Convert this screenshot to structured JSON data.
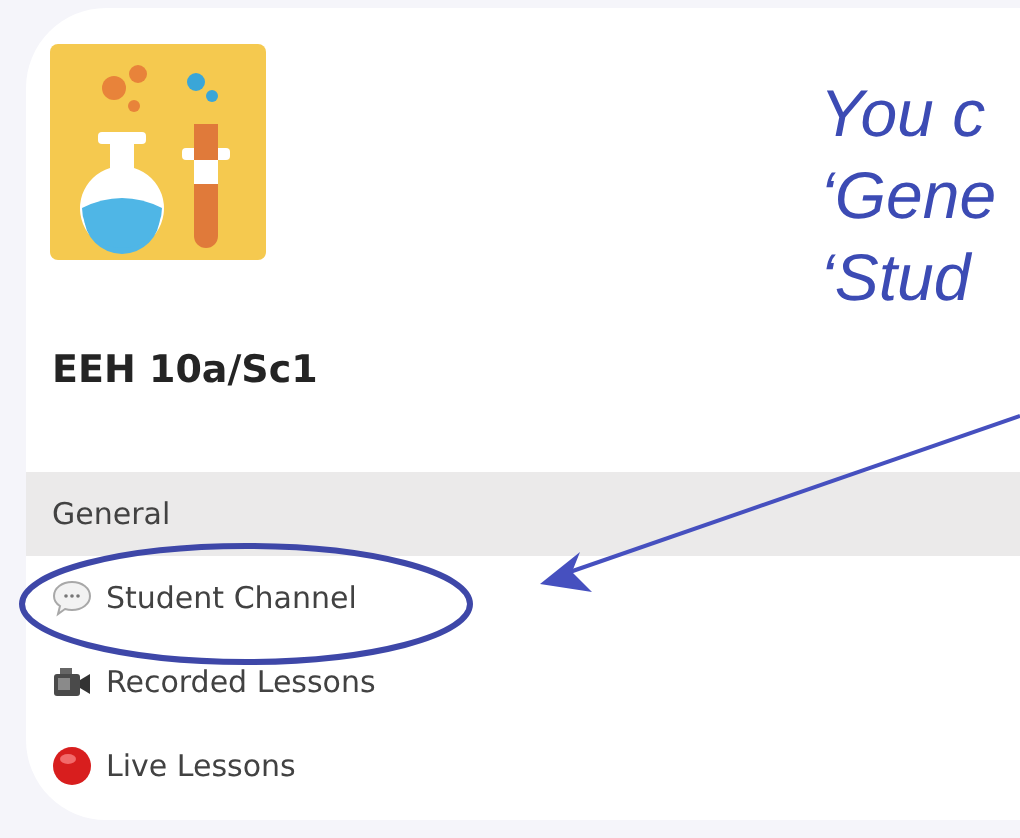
{
  "team": {
    "name": "EEH 10a/Sc1"
  },
  "channels": [
    {
      "name": "General",
      "kind": "plain",
      "selected": true
    },
    {
      "name": "Student Channel",
      "kind": "chat",
      "selected": false
    },
    {
      "name": "Recorded Lessons",
      "kind": "camera",
      "selected": false
    },
    {
      "name": "Live Lessons",
      "kind": "live",
      "selected": false
    }
  ],
  "annotation": {
    "lines": [
      "You c",
      "‘Gene",
      "‘Stud"
    ]
  }
}
